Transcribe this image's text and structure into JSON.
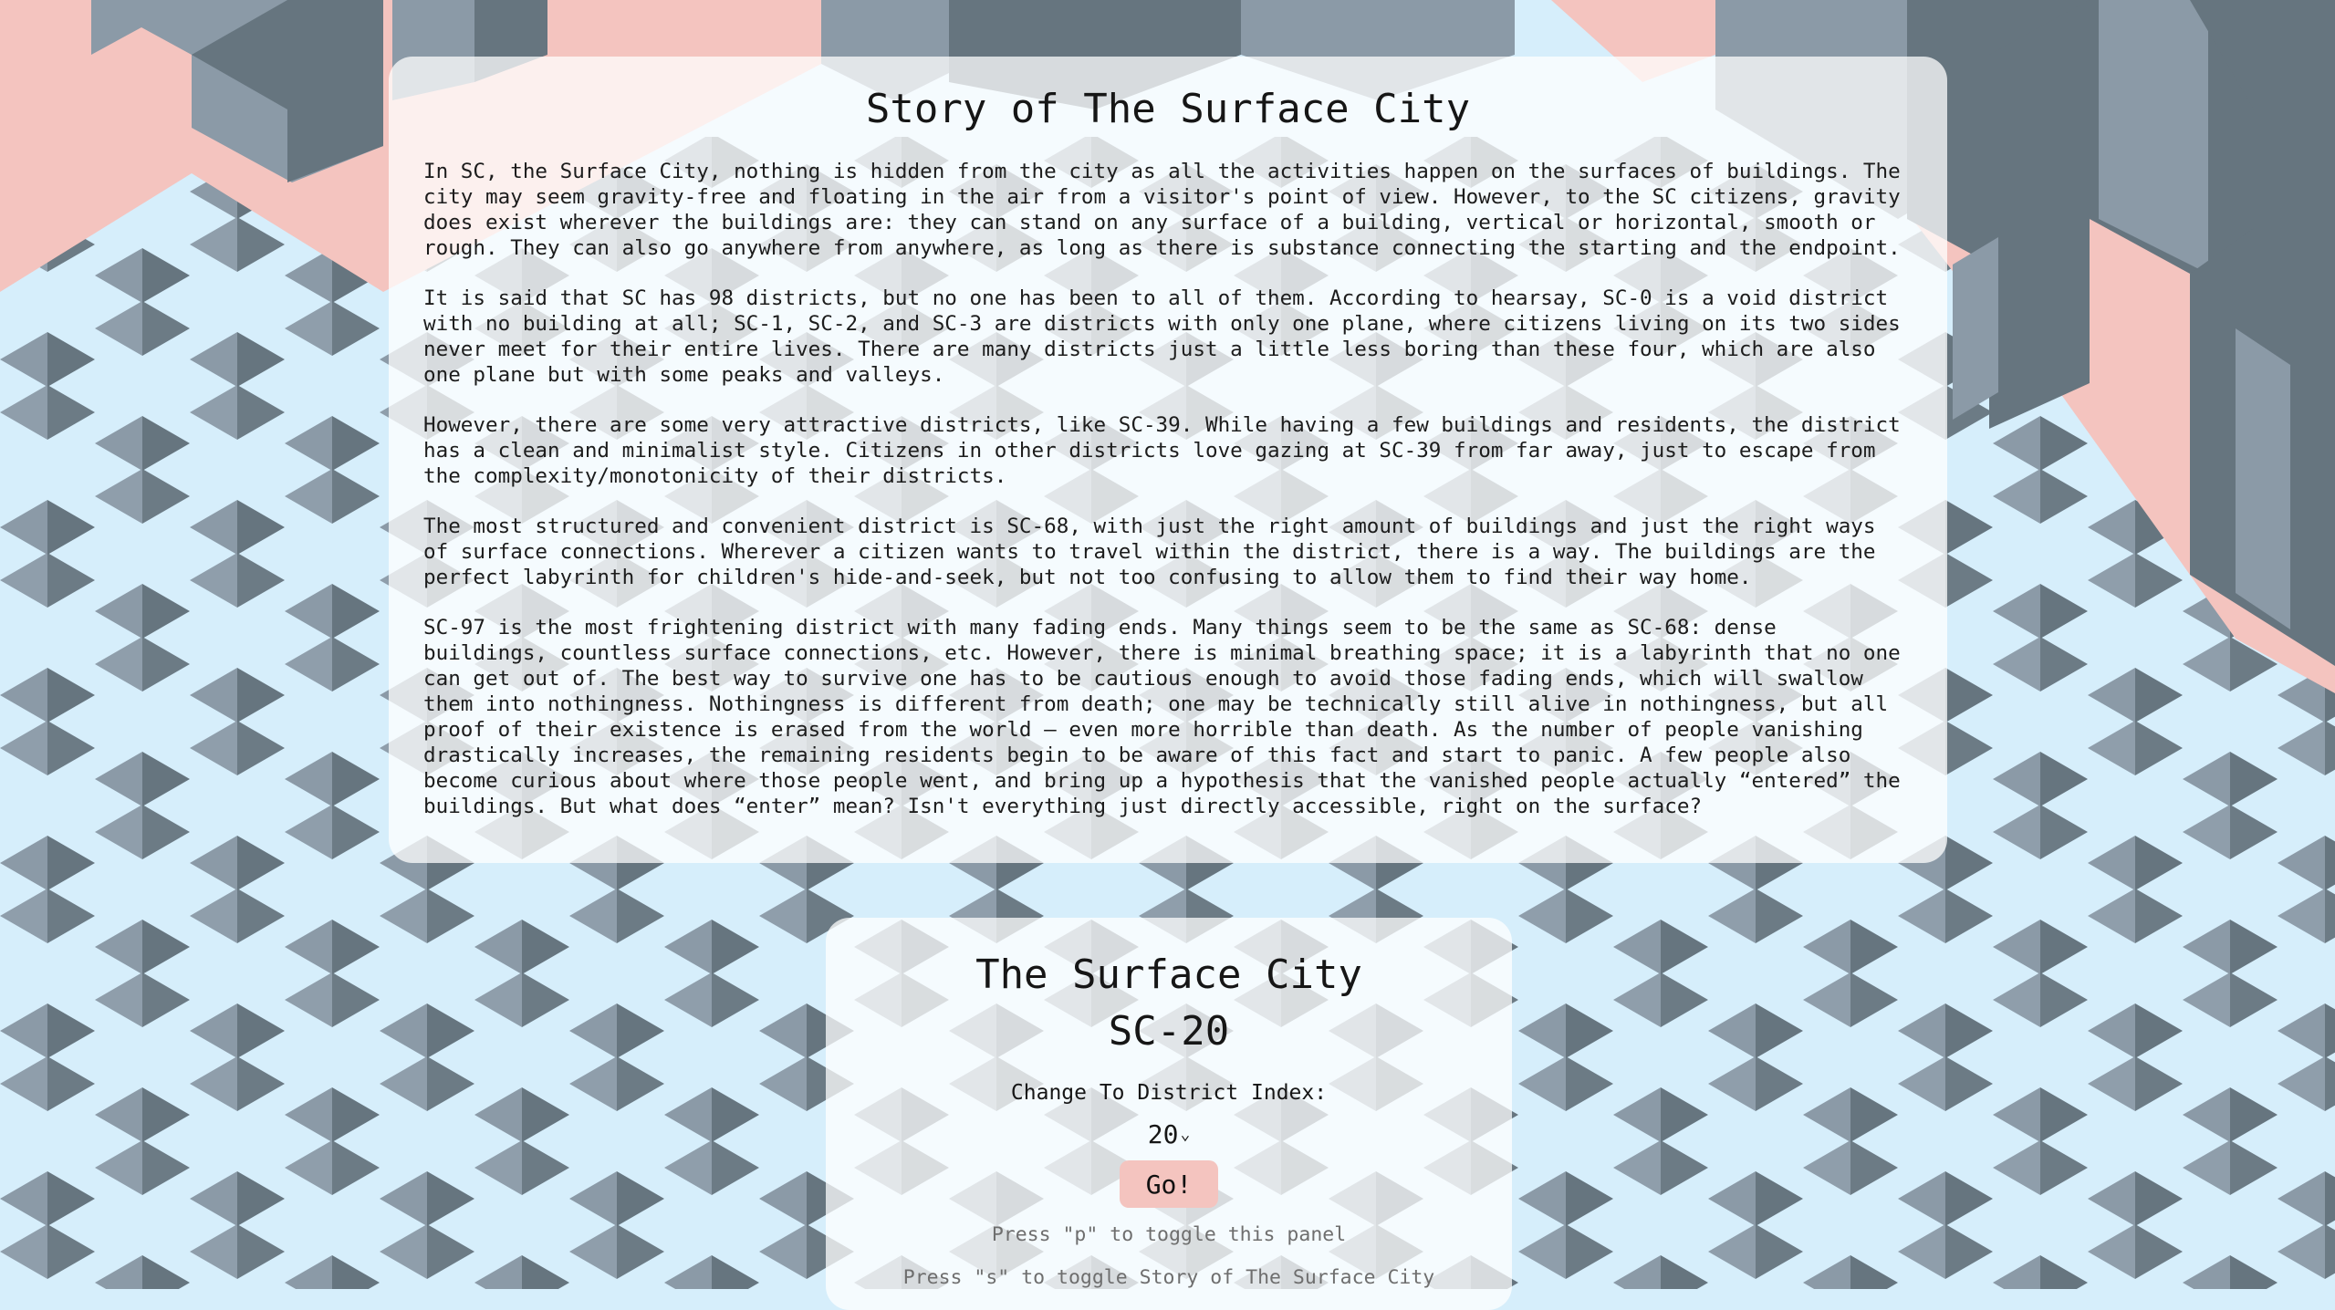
{
  "story": {
    "title": "Story of The Surface City",
    "paragraphs": [
      "In SC, the Surface City, nothing is hidden from the city as all the activities happen on the surfaces of buildings. The city may seem gravity-free and floating in the air from a visitor's point of view. However, to the SC citizens, gravity does exist wherever the buildings are: they can stand on any surface of a building, vertical or horizontal, smooth or rough. They can also go anywhere from anywhere, as long as there is substance connecting the starting and the endpoint.",
      "It is said that SC has 98 districts, but no one has been to all of them. According to hearsay, SC-0 is a void district with no building at all; SC-1, SC-2, and SC-3 are districts with only one plane, where citizens living on its two sides never meet for their entire lives. There are many districts just a little less boring than these four, which are also one plane but with some peaks and valleys.",
      "However, there are some very attractive districts, like SC-39. While having a few buildings and residents, the district has a clean and minimalist style. Citizens in other districts love gazing at SC-39 from far away, just to escape from the complexity/monotonicity of their districts.",
      "The most structured and convenient district is SC-68, with just the right amount of buildings and just the right ways of surface connections. Wherever a citizen wants to travel within the district, there is a way. The buildings are the perfect labyrinth for children's hide-and-seek, but not too confusing to allow them to find their way home.",
      "SC-97 is the most frightening district with many fading ends. Many things seem to be the same as SC-68: dense buildings, countless surface connections, etc. However, there is minimal breathing space; it is a labyrinth that no one can get out of. The best way to survive one has to be cautious enough to avoid those fading ends, which will swallow them into nothingness. Nothingness is different from death; one may be technically still alive in nothingness, but all proof of their existence is erased from the world — even more horrible than death. As the number of people vanishing drastically increases, the remaining residents begin to be aware of this fact and start to panic. A few people also become curious about where those people went, and bring up a hypothesis that the vanished people actually “entered” the buildings. But what does “enter” mean? Isn't everything just directly accessible, right on the surface?"
    ]
  },
  "panel": {
    "city_name": "The Surface City",
    "district_name": "SC-20",
    "change_label": "Change To District Index:",
    "selected_index": "20",
    "go_label": "Go!",
    "hint_panel": "Press \"p\" to toggle this panel",
    "hint_story": "Press \"s\" to toggle Story of The Surface City"
  },
  "colors": {
    "sky": "#d6eefb",
    "building_light": "#8b9aa7",
    "building_dark": "#66757f",
    "accent_pink": "#f4c4bf",
    "panel_bg": "rgba(255,255,255,0.74)"
  }
}
